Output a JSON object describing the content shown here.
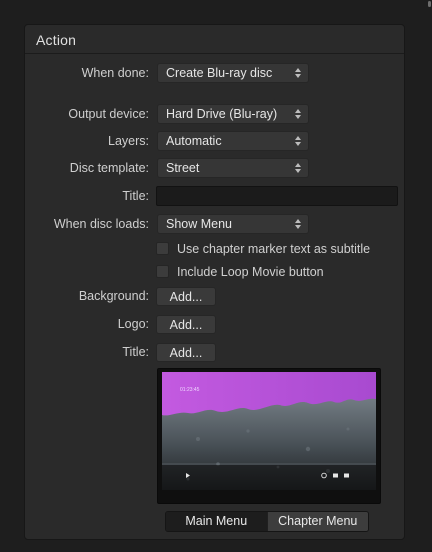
{
  "section": {
    "title": "Action"
  },
  "fields": {
    "when_done": {
      "label": "When done:",
      "value": "Create Blu-ray disc"
    },
    "output_device": {
      "label": "Output device:",
      "value": "Hard Drive (Blu-ray)"
    },
    "layers": {
      "label": "Layers:",
      "value": "Automatic"
    },
    "disc_template": {
      "label": "Disc template:",
      "value": "Street"
    },
    "title": {
      "label": "Title:",
      "value": ""
    },
    "when_disc_loads": {
      "label": "When disc loads:",
      "value": "Show Menu"
    }
  },
  "checkboxes": {
    "chapter_marker": {
      "label": "Use chapter marker text as subtitle",
      "checked": false
    },
    "loop_movie": {
      "label": "Include Loop Movie button",
      "checked": false
    }
  },
  "assets": {
    "background": {
      "label": "Background:",
      "button": "Add..."
    },
    "logo": {
      "label": "Logo:",
      "button": "Add..."
    },
    "title": {
      "label": "Title:",
      "button": "Add..."
    }
  },
  "preview": {
    "timecode": "01:23:45"
  },
  "menu_tabs": {
    "main": "Main Menu",
    "chapter": "Chapter Menu",
    "selected": "main"
  },
  "colors": {
    "panel": "#2a2a2a",
    "magenta": "#b04ed0",
    "field": "#363636"
  }
}
